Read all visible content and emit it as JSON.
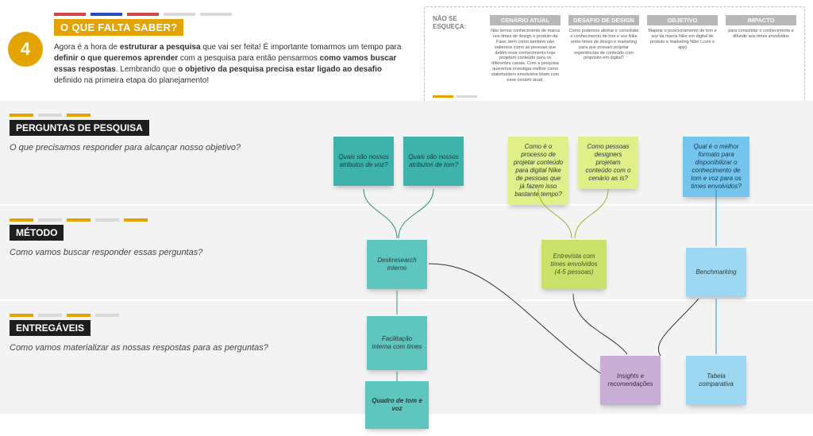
{
  "step_number": "4",
  "title": "O QUE FALTA SABER?",
  "intro_html": "Agora é a hora de <b>estruturar a pesquisa</b> que vai ser feita! É importante tomarmos um tempo para <b>definir o que queremos aprender</b> com a pesquisa para então pensarmos <b>como vamos buscar essas respostas</b>. Lembrando que <b>o objetivo da pesquisa precisa estar ligado ao desafio</b> definido na primeira etapa do planejamento!",
  "reminder": {
    "label": "NÃO SE ESQUEÇA:",
    "blocks": [
      {
        "head": "CENÁRIO ATUAL",
        "text": "Não temos conhecimento de marca nos times de design e produto da Fase, bem como também não sabemos como as pessoas que detêm esse conhecimento hoje projetam conteúdo para os diferentes canais. Com a pesquisa queremos investigar melhor como stakeholders envolvidos lidam com esse cenário atual."
      },
      {
        "head": "DESAFIO DE DESIGN",
        "text": "Como podemos alinhar e consolidar o conhecimento de tom e voz Nike entre times de design e marketing para que possam projetar experiências de conteúdo com propósito em digital?"
      },
      {
        "head": "OBJETIVO",
        "text": "Mapear o posicionamento de tom e voz da marca Nike em digital de produto e marketing Nike (.com e app)"
      },
      {
        "head": "IMPACTO",
        "text": "para consolidar o conhecimento e difundir aos times envolvidos"
      }
    ]
  },
  "bands": {
    "perguntas": {
      "heading": "PERGUNTAS DE PESQUISA",
      "sub": "O que precisamos responder para alcançar nosso objetivo?"
    },
    "metodo": {
      "heading": "MÉTODO",
      "sub": "Como vamos buscar responder essas perguntas?"
    },
    "entreg": {
      "heading": "ENTREGÁVEIS",
      "sub": "Como vamos materializar as nossas respostas para as perguntas?"
    }
  },
  "notes": {
    "q_voz": "Quais são nossos atributos de voz?",
    "q_tom": "Quais são nossos atributos de tom?",
    "q_proc": "Como é o processo de projetar conteúdo para digital Nike de pessoas que já fazem isso bastante tempo?",
    "q_design": "Como pessoas designers projetam conteúdo com o cenário as is?",
    "q_formato": "Qual é o melhor formato para disponibilizar o conhecimento de tom e voz para os times envolvidos?",
    "m_desk": "Deskresearch interno",
    "m_entrev": "Entrevista com times envolvidos (4-5 pessoas)",
    "m_bench": "Benchmarking",
    "e_fac": "Facilitação interna com times",
    "e_quadro": "Quadro de tom e voz",
    "e_insight": "Insights e recomendações",
    "e_tabela": "Tabela comparativa"
  }
}
